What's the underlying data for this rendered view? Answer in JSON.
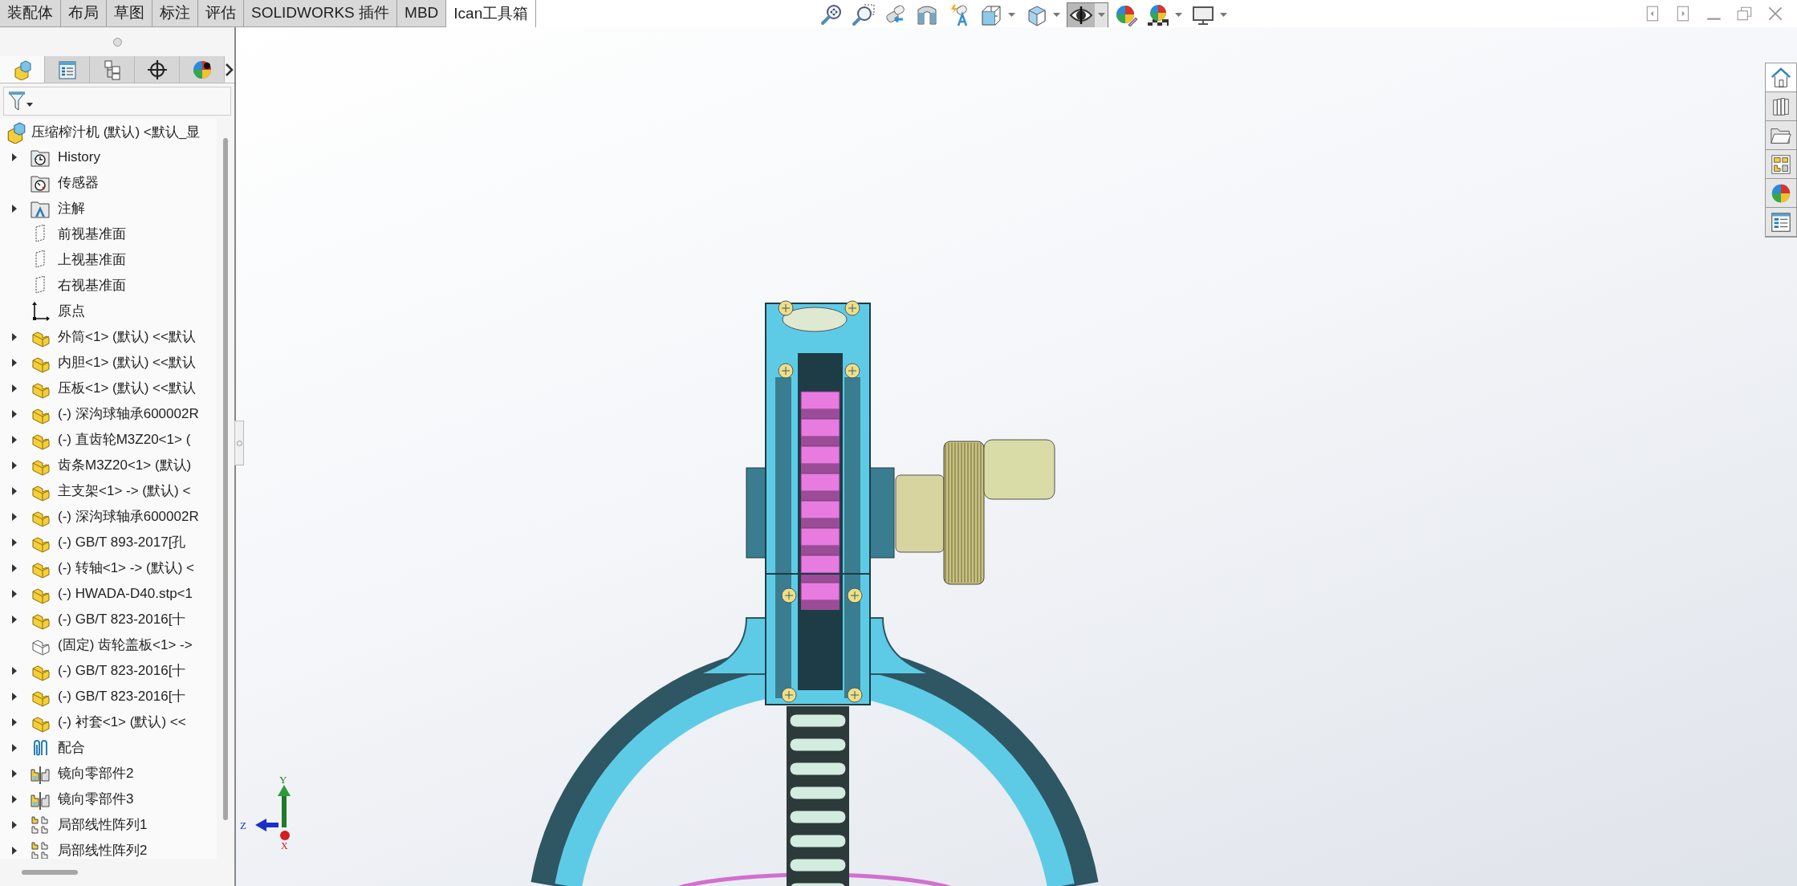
{
  "command_tabs": [
    {
      "label": "装配体",
      "selected": false
    },
    {
      "label": "布局",
      "selected": false
    },
    {
      "label": "草图",
      "selected": false
    },
    {
      "label": "标注",
      "selected": false
    },
    {
      "label": "评估",
      "selected": false
    },
    {
      "label": "SOLIDWORKS 插件",
      "selected": false
    },
    {
      "label": "MBD",
      "selected": false
    },
    {
      "label": "Ican工具箱",
      "selected": true
    }
  ],
  "view_toolbar": [
    {
      "kind": "zoom-fit",
      "dropdown": false,
      "selected": false
    },
    {
      "kind": "zoom-area",
      "dropdown": false,
      "selected": false
    },
    {
      "kind": "previous-view",
      "dropdown": false,
      "selected": false
    },
    {
      "kind": "section-view",
      "dropdown": false,
      "selected": false
    },
    {
      "kind": "dynamic-annotation",
      "dropdown": false,
      "selected": false
    },
    {
      "kind": "view-orientation",
      "dropdown": true,
      "selected": false
    },
    {
      "kind": "display-style",
      "dropdown": true,
      "selected": false
    },
    {
      "kind": "hide-show",
      "dropdown": true,
      "selected": true
    },
    {
      "kind": "edit-appearance",
      "dropdown": false,
      "selected": false
    },
    {
      "kind": "apply-scene",
      "dropdown": true,
      "selected": false
    },
    {
      "kind": "view-settings",
      "dropdown": true,
      "selected": false
    }
  ],
  "panel_tabs": [
    {
      "kind": "feature-tree",
      "selected": true
    },
    {
      "kind": "properties",
      "selected": false
    },
    {
      "kind": "configurations",
      "selected": false
    },
    {
      "kind": "dimxpert",
      "selected": false
    },
    {
      "kind": "display",
      "selected": false
    }
  ],
  "feature_tree": {
    "root": {
      "label": "压缩榨汁机 (默认) <默认_显"
    },
    "items": [
      {
        "kind": "history",
        "label": "History",
        "expandable": true
      },
      {
        "kind": "sensor",
        "label": "传感器",
        "expandable": false
      },
      {
        "kind": "annotation",
        "label": "注解",
        "expandable": true
      },
      {
        "kind": "plane",
        "label": "前视基准面",
        "expandable": false
      },
      {
        "kind": "plane",
        "label": "上视基准面",
        "expandable": false
      },
      {
        "kind": "plane",
        "label": "右视基准面",
        "expandable": false
      },
      {
        "kind": "origin",
        "label": "原点",
        "expandable": false
      },
      {
        "kind": "part",
        "label": "外筒<1> (默认) <<默认",
        "expandable": true
      },
      {
        "kind": "part",
        "label": "内胆<1> (默认) <<默认",
        "expandable": true
      },
      {
        "kind": "part",
        "label": "压板<1> (默认) <<默认",
        "expandable": true
      },
      {
        "kind": "part",
        "label": "(-) 深沟球轴承600002R",
        "expandable": true
      },
      {
        "kind": "part",
        "label": "(-) 直齿轮M3Z20<1> (",
        "expandable": true
      },
      {
        "kind": "part",
        "label": "齿条M3Z20<1> (默认)",
        "expandable": true
      },
      {
        "kind": "part",
        "label": "主支架<1> -> (默认) <",
        "expandable": true
      },
      {
        "kind": "part",
        "label": "(-) 深沟球轴承600002R",
        "expandable": true
      },
      {
        "kind": "part",
        "label": "(-) GB/T 893-2017[孔",
        "expandable": true
      },
      {
        "kind": "part",
        "label": "(-) 转轴<1> -> (默认) <",
        "expandable": true
      },
      {
        "kind": "part",
        "label": "(-) HWADA-D40.stp<1",
        "expandable": true
      },
      {
        "kind": "part",
        "label": "(-) GB/T 823-2016[十",
        "expandable": true
      },
      {
        "kind": "fixed-part",
        "label": "(固定) 齿轮盖板<1> ->",
        "expandable": false
      },
      {
        "kind": "part",
        "label": "(-) GB/T 823-2016[十",
        "expandable": true
      },
      {
        "kind": "part",
        "label": "(-) GB/T 823-2016[十",
        "expandable": true
      },
      {
        "kind": "part",
        "label": "(-) 衬套<1> (默认) <<",
        "expandable": true
      },
      {
        "kind": "mates",
        "label": "配合",
        "expandable": true
      },
      {
        "kind": "mirror",
        "label": "镜向零部件2",
        "expandable": true
      },
      {
        "kind": "mirror",
        "label": "镜向零部件3",
        "expandable": true
      },
      {
        "kind": "pattern",
        "label": "局部线性阵列1",
        "expandable": true
      },
      {
        "kind": "pattern",
        "label": "局部线性阵列2",
        "expandable": true
      }
    ]
  },
  "triad": {
    "x_label": "X",
    "y_label": "Y",
    "z_label": "Z"
  },
  "task_pane": [
    {
      "kind": "home",
      "selected": true
    },
    {
      "kind": "library",
      "selected": false
    },
    {
      "kind": "file-explorer",
      "selected": false
    },
    {
      "kind": "view-palette",
      "selected": false
    },
    {
      "kind": "appearances",
      "selected": false
    },
    {
      "kind": "custom-properties",
      "selected": false
    }
  ]
}
